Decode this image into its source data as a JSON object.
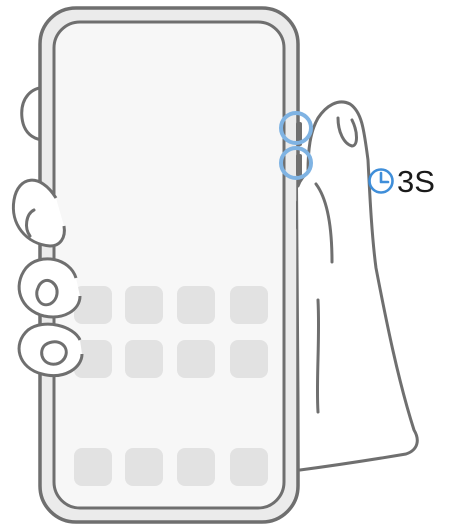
{
  "timer": {
    "label": "3S",
    "icon": "clock-icon"
  },
  "colors": {
    "outline": "#6f6f6f",
    "phone_body": "#ebebeb",
    "app_icon": "#e2e2e2",
    "screen": "#f7f7f7",
    "highlight": "#7fb3e3",
    "timer_icon": "#3f8ed9",
    "text": "#1a1a1a"
  },
  "home_screen": {
    "app_rows": 2,
    "app_columns": 4,
    "dock_icons": 4
  },
  "gesture": {
    "buttons_highlighted": [
      "volume-up-button",
      "power-button"
    ]
  }
}
